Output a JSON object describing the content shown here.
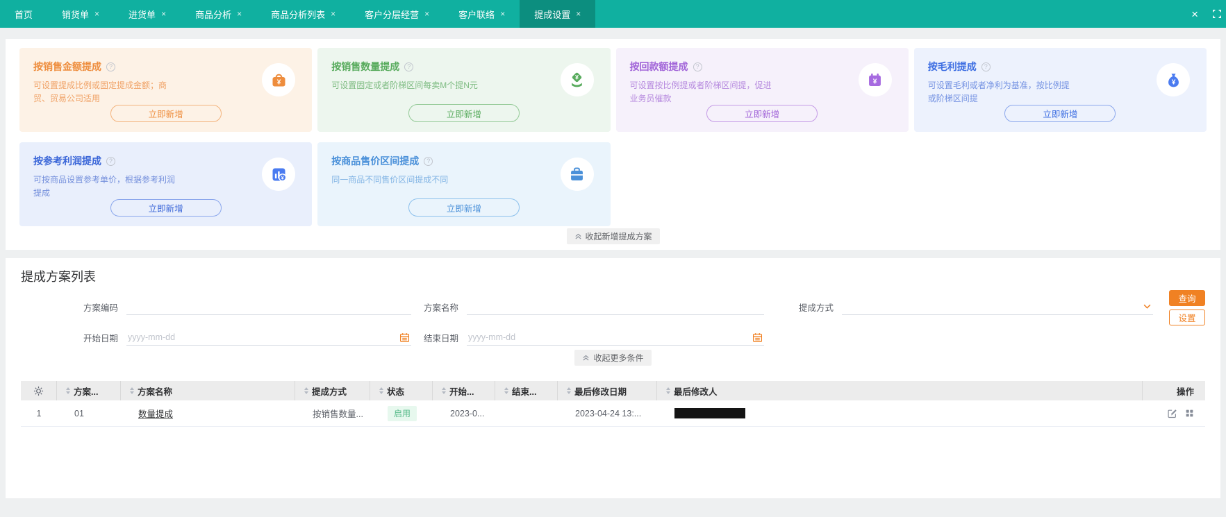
{
  "tabbar": {
    "tabs": [
      {
        "label": "首页",
        "closable": false
      },
      {
        "label": "销货单",
        "closable": true
      },
      {
        "label": "进货单",
        "closable": true
      },
      {
        "label": "商品分析",
        "closable": true
      },
      {
        "label": "商品分析列表",
        "closable": true
      },
      {
        "label": "客户分层经营",
        "closable": true
      },
      {
        "label": "客户联络",
        "closable": true
      },
      {
        "label": "提成设置",
        "closable": true,
        "active": true
      }
    ],
    "close_glyph": "×"
  },
  "glyphs": {
    "help": "?"
  },
  "colors": {
    "tabbar_bg": "#10b0a0",
    "tabbar_active_bg": "#0c8e7f",
    "accent_orange": "#f08123",
    "card_orange": "#ee8d3d",
    "card_green": "#58ab5d",
    "card_purple": "#a164d8",
    "card_blue": "#3d6ee2",
    "card_lightblue": "#4a90d9",
    "status_green": "#57bb8a"
  },
  "cards": [
    {
      "title": "按销售金额提成",
      "desc": "可设置提成比例或固定提成金额；商贸、贸易公司适用",
      "button": "立即新增",
      "icon": "money-purse",
      "theme": "orange"
    },
    {
      "title": "按销售数量提成",
      "desc": "可设置固定或者阶梯区间每卖M个提N元",
      "button": "立即新增",
      "icon": "hand-coin",
      "theme": "green"
    },
    {
      "title": "按回款额提成",
      "desc": "可设置按比例提或者阶梯区间提，促进业务员催款",
      "button": "立即新增",
      "icon": "calendar-money",
      "theme": "purple"
    },
    {
      "title": "按毛利提成",
      "desc": "可设置毛利或者净利为基准，按比例提或阶梯区间提",
      "button": "立即新增",
      "icon": "money-bag",
      "theme": "blue"
    },
    {
      "title": "按参考利润提成",
      "desc": "可按商品设置参考单价，根据参考利润提成",
      "button": "立即新增",
      "icon": "chart-money",
      "theme": "blue2"
    },
    {
      "title": "按商品售价区间提成",
      "desc": "同一商品不同售价区间提成不同",
      "button": "立即新增",
      "icon": "briefcase",
      "theme": "lightblue"
    }
  ],
  "cards_collapse_label": "收起新增提成方案",
  "list": {
    "title": "提成方案列表",
    "form": {
      "code_label": "方案编码",
      "name_label": "方案名称",
      "method_label": "提成方式",
      "start_label": "开始日期",
      "end_label": "结束日期",
      "date_placeholder": "yyyy-mm-dd",
      "search_button": "查询",
      "settings_button": "设置",
      "collapse_label": "收起更多条件"
    },
    "table": {
      "columns": [
        "方案...",
        "方案名称",
        "提成方式",
        "状态",
        "开始...",
        "结束...",
        "最后修改日期",
        "最后修改人",
        "操作"
      ],
      "rows": [
        {
          "index": "1",
          "code": "01",
          "name": "数量提成",
          "method": "按销售数量...",
          "status": "启用",
          "start": "2023-0...",
          "end": "",
          "modified_date": "2023-04-24 13:...",
          "modified_by_masked": true
        }
      ]
    }
  }
}
